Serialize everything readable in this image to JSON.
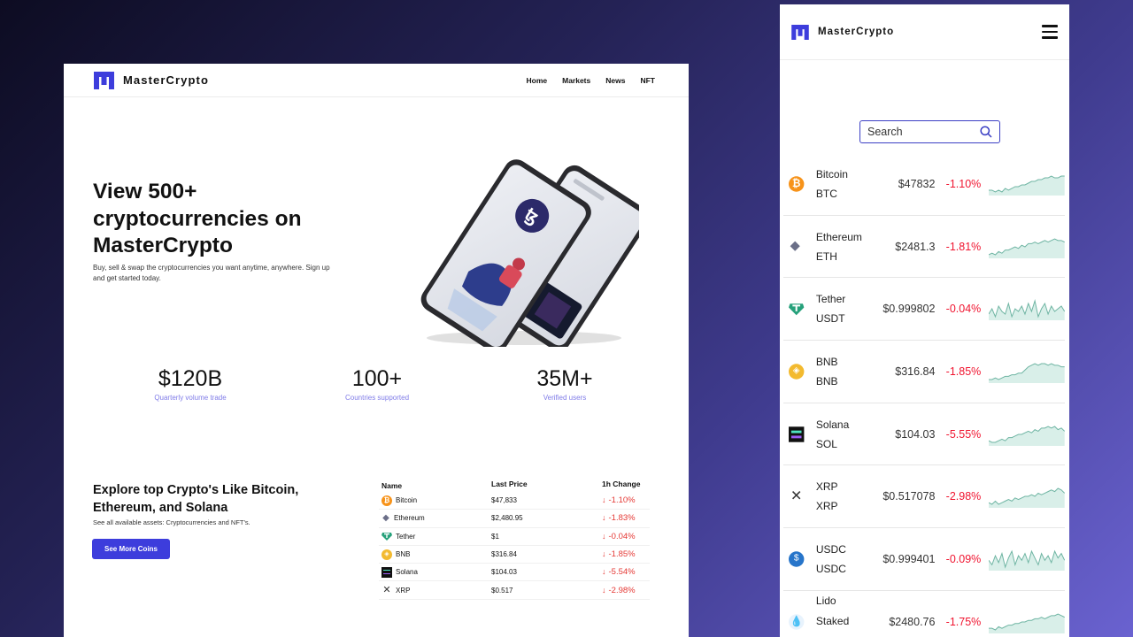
{
  "brand": {
    "name": "MasterCrypto",
    "accent": "#3d3ddc"
  },
  "desktop": {
    "nav": [
      "Home",
      "Markets",
      "News",
      "NFT"
    ],
    "hero": {
      "title": "View 500+ cryptocurrencies on MasterCrypto",
      "subtitle": "Buy, sell & swap the cryptocurrencies you want anytime, anywhere. Sign up and get started today."
    },
    "stats": [
      {
        "value": "$120B",
        "label": "Quarterly volume trade"
      },
      {
        "value": "100+",
        "label": "Countries supported"
      },
      {
        "value": "35M+",
        "label": "Verified users"
      }
    ],
    "explore": {
      "title": "Explore top Crypto's Like Bitcoin, Ethereum, and Solana",
      "subtitle": "See all available assets: Cryptocurrencies and NFT's.",
      "button": "See More Coins"
    },
    "table": {
      "headers": [
        "Name",
        "Last Price",
        "1h Change"
      ],
      "rows": [
        {
          "icon": "bitcoin-icon",
          "name": "Bitcoin",
          "price": "$47,833",
          "change": "-1.10%"
        },
        {
          "icon": "ethereum-icon",
          "name": "Ethereum",
          "price": "$2,480.95",
          "change": "-1.83%"
        },
        {
          "icon": "tether-icon",
          "name": "Tether",
          "price": "$1",
          "change": "-0.04%"
        },
        {
          "icon": "bnb-icon",
          "name": "BNB",
          "price": "$316.84",
          "change": "-1.85%"
        },
        {
          "icon": "solana-icon",
          "name": "Solana",
          "price": "$104.03",
          "change": "-5.54%"
        },
        {
          "icon": "xrp-icon",
          "name": "XRP",
          "price": "$0.517",
          "change": "-2.98%"
        }
      ]
    }
  },
  "mobile": {
    "search_placeholder": "Search",
    "coins": [
      {
        "icon": "bitcoin-icon",
        "name": "Bitcoin",
        "symbol": "BTC",
        "price": "$47832",
        "change": "-1.10%",
        "trend": [
          3,
          3,
          2,
          3,
          2,
          4,
          3,
          4,
          5,
          5,
          6,
          6,
          7,
          8,
          8,
          9,
          9,
          10,
          10,
          11,
          10,
          10,
          11,
          11
        ]
      },
      {
        "icon": "ethereum-icon",
        "name": "Ethereum",
        "symbol": "ETH",
        "price": "$2481.3",
        "change": "-1.81%",
        "trend": [
          2,
          3,
          2,
          4,
          3,
          5,
          5,
          6,
          7,
          6,
          8,
          7,
          9,
          9,
          10,
          9,
          10,
          11,
          10,
          11,
          12,
          11,
          11,
          10
        ]
      },
      {
        "icon": "tether-icon",
        "name": "Tether",
        "symbol": "USDT",
        "price": "$0.999802",
        "change": "-0.04%",
        "trend": [
          5,
          7,
          4,
          8,
          6,
          5,
          9,
          4,
          7,
          6,
          8,
          5,
          9,
          6,
          10,
          4,
          7,
          9,
          5,
          8,
          6,
          7,
          8,
          6
        ]
      },
      {
        "icon": "bnb-icon",
        "name": "BNB",
        "symbol": "BNB",
        "price": "$316.84",
        "change": "-1.85%",
        "trend": [
          2,
          2,
          3,
          2,
          3,
          4,
          4,
          5,
          5,
          6,
          6,
          8,
          10,
          11,
          12,
          11,
          12,
          12,
          11,
          12,
          11,
          11,
          10,
          10
        ]
      },
      {
        "icon": "solana-icon",
        "name": "Solana",
        "symbol": "SOL",
        "price": "$104.03",
        "change": "-5.55%",
        "trend": [
          3,
          2,
          2,
          3,
          4,
          3,
          5,
          5,
          6,
          7,
          7,
          8,
          9,
          8,
          10,
          9,
          11,
          11,
          12,
          11,
          12,
          10,
          11,
          9
        ]
      },
      {
        "icon": "xrp-icon",
        "name": "XRP",
        "symbol": "XRP",
        "price": "$0.517078",
        "change": "-2.98%",
        "trend": [
          4,
          3,
          5,
          3,
          4,
          5,
          6,
          5,
          7,
          6,
          7,
          8,
          8,
          9,
          8,
          10,
          9,
          10,
          11,
          12,
          11,
          13,
          12,
          10
        ]
      },
      {
        "icon": "usdc-icon",
        "name": "USDC",
        "symbol": "USDC",
        "price": "$0.999401",
        "change": "-0.09%",
        "trend": [
          6,
          4,
          8,
          5,
          9,
          3,
          7,
          10,
          4,
          8,
          6,
          9,
          5,
          10,
          7,
          4,
          9,
          6,
          8,
          5,
          10,
          7,
          9,
          6
        ]
      },
      {
        "icon": "lido-icon",
        "name": "Lido Staked Ether",
        "symbol": "",
        "price": "$2480.76",
        "change": "-1.75%",
        "trend": [
          3,
          3,
          2,
          4,
          3,
          4,
          5,
          5,
          6,
          6,
          7,
          7,
          8,
          8,
          9,
          9,
          10,
          9,
          10,
          11,
          11,
          12,
          11,
          10
        ]
      }
    ]
  }
}
